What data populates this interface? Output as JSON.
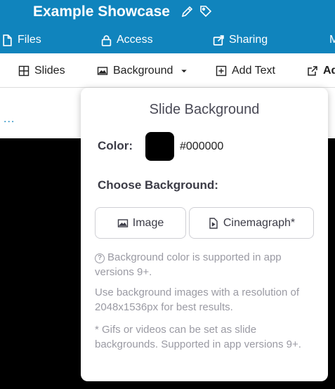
{
  "header": {
    "title": "Example Showcase",
    "nav": [
      {
        "label": "Files",
        "icon": "file-icon"
      },
      {
        "label": "Access",
        "icon": "lock-icon"
      },
      {
        "label": "Sharing",
        "icon": "share-icon"
      },
      {
        "label": "M",
        "icon": ""
      }
    ]
  },
  "toolbar": {
    "slides_label": "Slides",
    "background_label": "Background",
    "add_text_label": "Add Text",
    "ad_label": "Ad"
  },
  "canvas": {
    "more_label": "..."
  },
  "popover": {
    "title": "Slide Background",
    "color_label": "Color:",
    "color_value": "#000000",
    "choose_label": "Choose Background:",
    "image_button": "Image",
    "cinemagraph_button": "Cinemagraph*",
    "note_support": "Background color is supported in app versions 9+.",
    "note_resolution": "Use background images with a resolution of 2048x1536px for best results.",
    "note_gifs": "* Gifs or videos can be set as slide backgrounds. Supported in app versions 9+."
  },
  "colors": {
    "header_bg": "#1084bd",
    "canvas_bg": "#000000",
    "text_muted": "#9a9aa3"
  }
}
